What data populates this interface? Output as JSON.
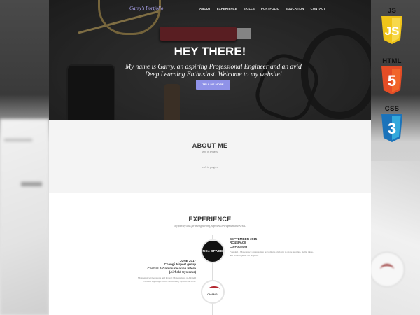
{
  "site": {
    "brand": "Garry's Portfolio",
    "nav": [
      "ABOUT",
      "EXPERIENCE",
      "SKILLS",
      "PORTFOLIO",
      "EDUCATION",
      "CONTACT"
    ],
    "hero": {
      "title": "HEY THERE!",
      "subtitle": "My name is Garry, an aspiring Professional Engineer and an avid Deep Learning Enthusiast. Welcome to my website!",
      "button": "TELL ME MORE"
    },
    "about": {
      "title": "ABOUT ME",
      "subtitle": "work in progress",
      "body": "work in progress"
    },
    "experience": {
      "title": "EXPERIENCE",
      "subtitle": "My journey thus far in Engineering, Software Development and AI/ML",
      "entries": [
        {
          "date": "SEPTEMBER 2015",
          "org": "RC4SPACE",
          "role": "Co-Founder",
          "logo_text": "RC4 SPACE",
          "description": "Founded a Makerspace organisation providing a platform to share supplies, skills, ideas, and work together on projects."
        },
        {
          "date": "JUNE 2017",
          "org": "Changi Airport group",
          "role": "Control & Communication Intern",
          "dept": "(Airfield Systems)",
          "logo_text": "CHANGI",
          "description": "Maintenance Operations and Project Management of Airfield Ground Lighting Control Monitoring System and AGL"
        }
      ]
    }
  },
  "logos": [
    {
      "label": "JS",
      "icon": "js-shield-icon",
      "color": "#f0c419",
      "mark": "JS"
    },
    {
      "label": "HTML",
      "icon": "html5-shield-icon",
      "color": "#e44d26",
      "mark": "5"
    },
    {
      "label": "CSS",
      "icon": "css3-shield-icon",
      "color": "#1b73ba",
      "mark": "3"
    }
  ]
}
